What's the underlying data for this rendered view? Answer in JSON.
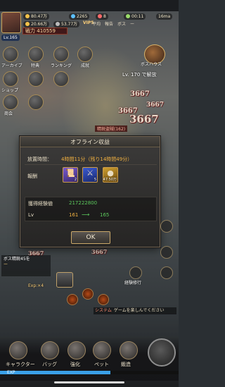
{
  "hud": {
    "resources": [
      {
        "value": "80.47万",
        "color": "#f3c24a"
      },
      {
        "value": "2265",
        "color": "#5cc0ff"
      },
      {
        "value": "8",
        "color": "#ff6a6a"
      },
      {
        "value": "00:11",
        "color": "#9bdc6a"
      },
      {
        "value": "16ma",
        "color": "#cccccc"
      }
    ],
    "sub_resources": [
      {
        "value": "20.66万",
        "color": "#f3c24a"
      },
      {
        "value": "53.77万",
        "color": "#bbbbbb"
      }
    ],
    "vip": "VIP5",
    "tabs": [
      "平均",
      "報告",
      "ボス",
      "ー"
    ],
    "power_label": "戦力",
    "power_value": "410559",
    "level": "Lv.165"
  },
  "side_menu": [
    {
      "label": "アーカイブ"
    },
    {
      "label": "特典"
    },
    {
      "label": "ランキング"
    },
    {
      "label": "成就"
    },
    {
      "label": "ショップ"
    },
    {
      "label": "ー"
    },
    {
      "label": "ー"
    },
    {
      "label": "商会"
    },
    {
      "label": "ー"
    },
    {
      "label": "ー"
    }
  ],
  "boss": {
    "label": "ボスハウス",
    "stage": "Lv. 170 で解放"
  },
  "battle": {
    "damage_numbers": [
      "3667",
      "3667",
      "3667",
      "3667",
      "3667",
      "3667"
    ],
    "enemy_tag": "精鋭盗賊(162)"
  },
  "dialog": {
    "title": "オフライン収益",
    "time_label": "放置時間：",
    "time_value": "4時間11分（残り14時間49分）",
    "reward_label": "報酬",
    "rewards": [
      {
        "icon": "scroll-icon",
        "count": "2"
      },
      {
        "icon": "sword-icon",
        "count": "5"
      },
      {
        "icon": "gold-coin-icon",
        "count": "47.50万"
      }
    ],
    "exp_label": "獲得経験値",
    "exp_value": "217222800",
    "lv_label": "Lv",
    "lv_from": "161",
    "lv_to": "165",
    "ok_label": "OK"
  },
  "quest": {
    "line1": "ボス精鋭45を",
    "line2": "ー",
    "extra": "Exp:×4"
  },
  "auto_label": "経験修行",
  "chat": {
    "channel": "システム",
    "text": "ゲームを楽しんでください"
  },
  "nav": [
    {
      "label": "キャラクター"
    },
    {
      "label": "バッグ"
    },
    {
      "label": "強化"
    },
    {
      "label": "ペット"
    },
    {
      "label": "鍛造"
    }
  ],
  "exp_bar": {
    "label": "EXP",
    "fill_fraction": 0.62
  }
}
